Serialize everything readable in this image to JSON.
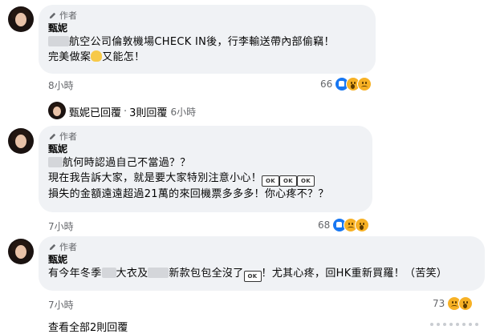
{
  "comments": [
    {
      "author_tag": "作者",
      "name": "甄妮",
      "lines": [
        {
          "pre": "",
          "mid": "航空公司倫敦機場CHECK IN後，行李輸送帶內部偷竊！"
        },
        {
          "pre": "完美做案",
          "mid": "又能怎！"
        }
      ],
      "time": "8小時",
      "reactions": "66"
    },
    {
      "author_tag": "作者",
      "name": "甄妮",
      "lines": [
        {
          "pre": "",
          "mid": "航何時認過自己不當過？？"
        },
        {
          "pre": "現在我告訴大家，就是要大家特別注意小心！",
          "mid": ""
        },
        {
          "pre": "損失的金額遠遠超過21萬的來回機票多多多！你心疼不？？",
          "mid": ""
        }
      ],
      "time": "7小時",
      "reactions": "68"
    },
    {
      "author_tag": "作者",
      "name": "甄妮",
      "line_a": "有今年冬季",
      "line_b": "大衣及",
      "line_c": "新款包包全沒了",
      "line_d": "！尤其心疼，回HK重新買羅！（苦笑）",
      "time": "7小時",
      "reactions": "73"
    }
  ],
  "reply_summary": {
    "text": "甄妮已回覆",
    "sep": "·",
    "count": "3則回覆",
    "time": "6小時"
  },
  "view_all": "查看全部2則回覆",
  "ok_emoji_text": "OK",
  "colors": {
    "bubble": "#f0f2f5",
    "like": "#1877f2",
    "emoji": "#f7b125"
  }
}
